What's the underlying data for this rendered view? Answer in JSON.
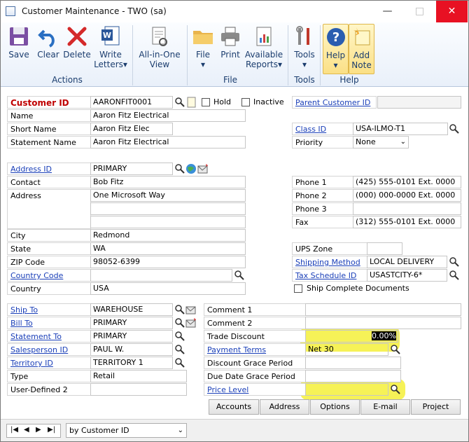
{
  "window": {
    "title": "Customer Maintenance  -  TWO (sa)"
  },
  "ribbon": {
    "buttons": {
      "save": "Save",
      "clear": "Clear",
      "delete": "Delete",
      "write_letters": "Write",
      "write_letters2": "Letters",
      "allinone": "All-in-One",
      "allinone2": "View",
      "file": "File",
      "print": "Print",
      "available_reports": "Available",
      "available_reports2": "Reports",
      "tools": "Tools",
      "help": "Help",
      "add_note": "Add",
      "add_note2": "Note"
    },
    "groups": {
      "actions": "Actions",
      "file": "File",
      "tools": "Tools",
      "help": "Help"
    }
  },
  "form": {
    "customer_id_label": "Customer ID",
    "customer_id": "AARONFIT0001",
    "hold_label": "Hold",
    "inactive_label": "Inactive",
    "parent_customer_id_label": "Parent Customer ID",
    "parent_customer_id": "",
    "name_label": "Name",
    "name": "Aaron Fitz Electrical",
    "short_name_label": "Short Name",
    "short_name": "Aaron Fitz Elec",
    "statement_name_label": "Statement Name",
    "statement_name": "Aaron Fitz Electrical",
    "class_id_label": "Class ID",
    "class_id": "USA-ILMO-T1",
    "priority_label": "Priority",
    "priority": "None",
    "address_id_label": "Address ID",
    "address_id": "PRIMARY",
    "contact_label": "Contact",
    "contact": "Bob Fitz",
    "address_label": "Address",
    "address1": "One Microsoft Way",
    "address2": "",
    "address3": "",
    "city_label": "City",
    "city": "Redmond",
    "state_label": "State",
    "state": "WA",
    "zip_label": "ZIP Code",
    "zip": "98052-6399",
    "country_code_label": "Country Code",
    "country_code": "",
    "country_label": "Country",
    "country": "USA",
    "phone1_label": "Phone 1",
    "phone1": "(425) 555-0101  Ext. 0000",
    "phone2_label": "Phone 2",
    "phone2": "(000) 000-0000  Ext. 0000",
    "phone3_label": "Phone 3",
    "phone3": "",
    "fax_label": "Fax",
    "fax": "(312) 555-0101  Ext. 0000",
    "ups_zone_label": "UPS Zone",
    "ups_zone": "",
    "shipping_method_label": "Shipping Method",
    "shipping_method": "LOCAL DELIVERY",
    "tax_schedule_label": "Tax Schedule ID",
    "tax_schedule": "USASTCITY-6*",
    "ship_complete_label": "Ship Complete Documents",
    "ship_to_label": "Ship To",
    "ship_to": "WAREHOUSE",
    "bill_to_label": "Bill To",
    "bill_to": "PRIMARY",
    "statement_to_label": "Statement To",
    "statement_to": "PRIMARY",
    "salesperson_label": "Salesperson ID",
    "salesperson": "PAUL W.",
    "territory_label": "Territory ID",
    "territory": "TERRITORY 1",
    "type_label": "Type",
    "type": "Retail",
    "user_defined2_label": "User-Defined 2",
    "user_defined2": "",
    "comment1_label": "Comment 1",
    "comment1": "",
    "comment2_label": "Comment 2",
    "comment2": "",
    "trade_discount_label": "Trade Discount",
    "trade_discount": "0.00%",
    "payment_terms_label": "Payment Terms",
    "payment_terms": "Net 30",
    "discount_grace_label": "Discount Grace Period",
    "discount_grace": "",
    "due_date_grace_label": "Due Date Grace Period",
    "due_date_grace": "",
    "price_level_label": "Price Level",
    "price_level": ""
  },
  "buttons": {
    "accounts": "Accounts",
    "address": "Address",
    "options": "Options",
    "email": "E-mail",
    "project": "Project"
  },
  "footer": {
    "sort": "by Customer ID"
  },
  "colors": {
    "link": "#1a3fb8",
    "required": "#c00000",
    "highlight": "#f4f03a"
  }
}
